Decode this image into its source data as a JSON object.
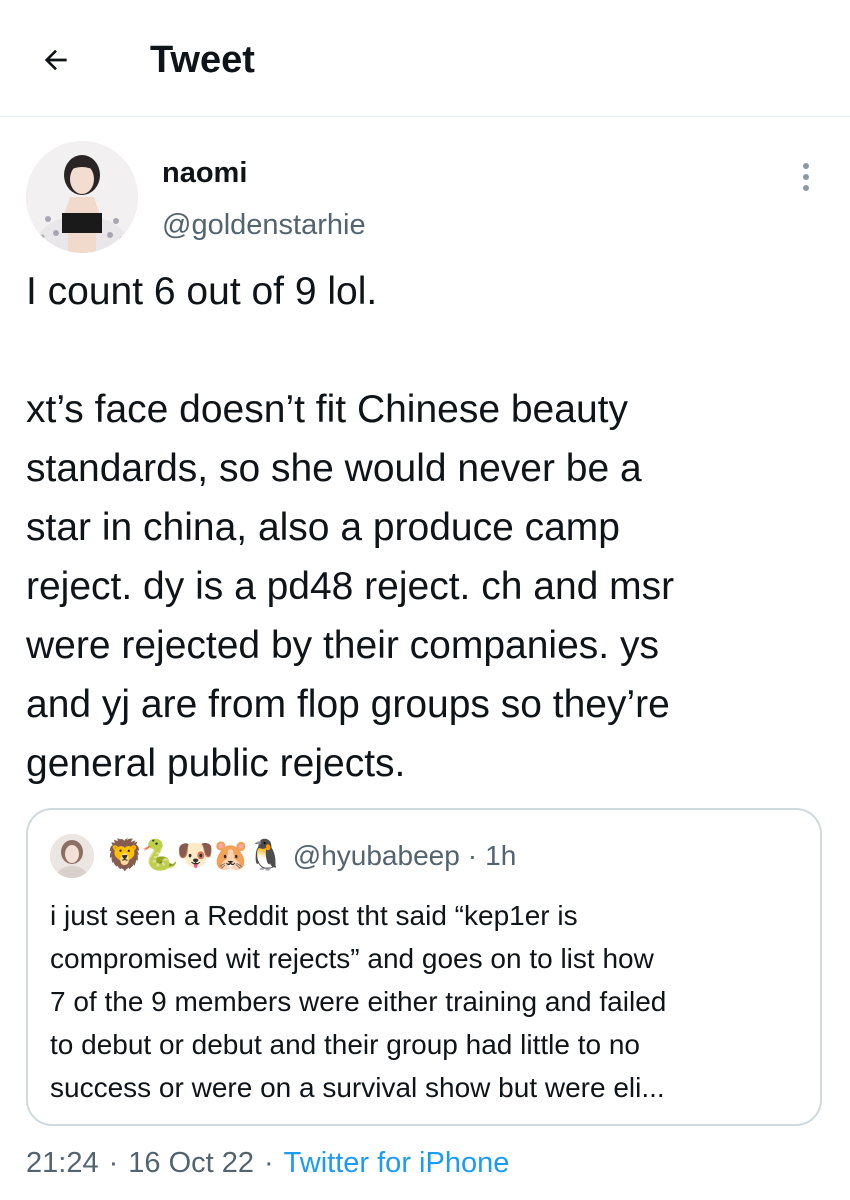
{
  "header": {
    "back_icon": "arrow-left-icon",
    "title": "Tweet"
  },
  "tweet": {
    "author": {
      "display_name": "naomi",
      "handle": "@goldenstarhie",
      "avatar": "profile-photo"
    },
    "more_icon": "more-vertical-icon",
    "text_paragraphs": [
      "I count 6 out of 9 lol.",
      "xt’s face doesn’t fit Chinese beauty\nstandards, so she would never be a\nstar in china, also a produce camp\nreject. dy is a pd48 reject. ch and msr\nwere rejected by their companies. ys\nand yj are from flop groups so they’re\ngeneral public rejects."
    ],
    "quoted": {
      "emojis": "🦁🐍🐶🐹🐧",
      "handle": "@hyubabeep",
      "separator": "·",
      "time": "1h",
      "text": "i just seen a Reddit post tht said “kep1er is\ncompromised wit rejects” and goes on to list how\n7 of the 9 members were either training and failed\nto debut or debut and their group had little to no\nsuccess or were on a survival show but were eli..."
    },
    "meta": {
      "time": "21:24",
      "separator": "·",
      "date": "16 Oct 22",
      "separator2": "·",
      "source": "Twitter for iPhone"
    }
  },
  "colors": {
    "text": "#0f1419",
    "secondary": "#536471",
    "link": "#1d9bf0",
    "border": "#cfd9de"
  }
}
